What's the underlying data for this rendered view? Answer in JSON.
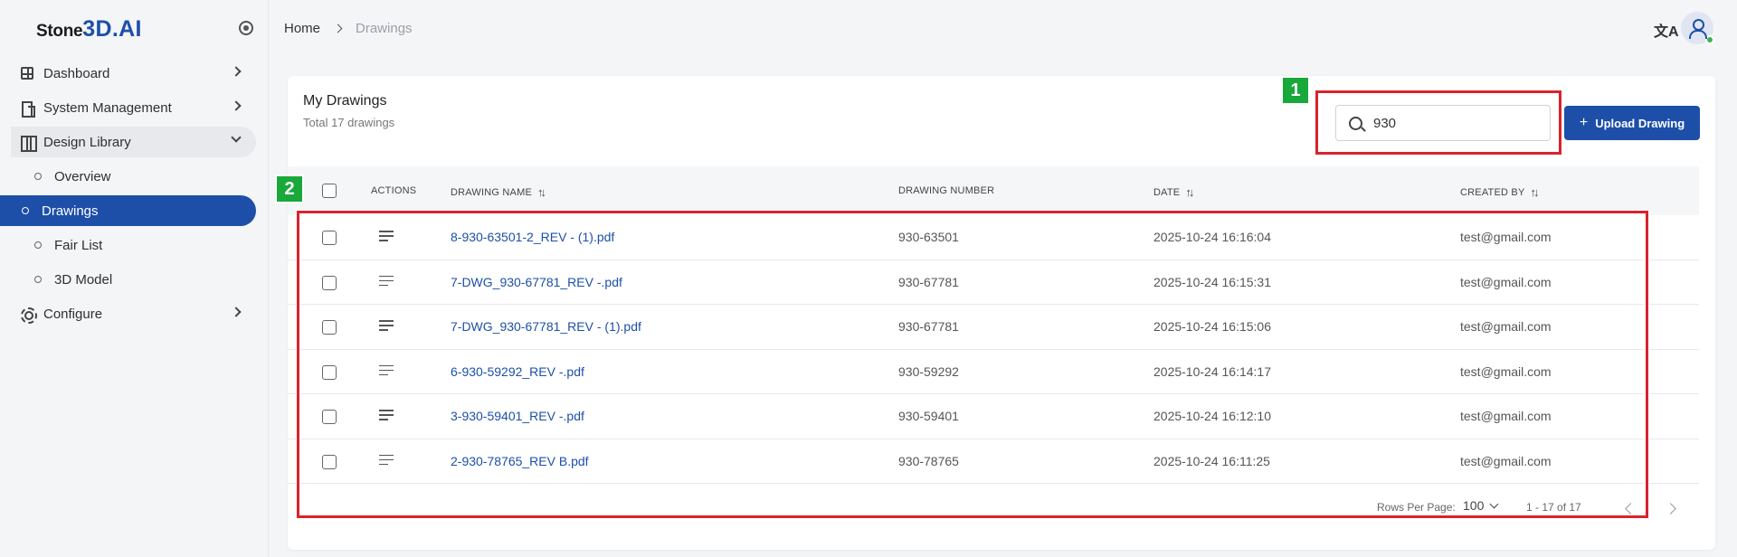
{
  "brand": {
    "part1": "Stone",
    "part2": "3D.AI"
  },
  "sidebar": {
    "items": [
      {
        "label": "Dashboard"
      },
      {
        "label": "System Management"
      },
      {
        "label": "Design Library"
      },
      {
        "label": "Overview"
      },
      {
        "label": "Drawings"
      },
      {
        "label": "Fair List"
      },
      {
        "label": "3D Model"
      },
      {
        "label": "Configure"
      }
    ]
  },
  "breadcrumb": {
    "home": "Home",
    "current": "Drawings"
  },
  "header": {
    "translate_glyph": "文A"
  },
  "card": {
    "title": "My Drawings",
    "subtitle": "Total 17 drawings",
    "search_value": "930",
    "upload_label": "Upload Drawing",
    "upload_plus": "+"
  },
  "table": {
    "headers": {
      "actions": "Actions",
      "name": "Drawing Name",
      "number": "Drawing Number",
      "date": "Date",
      "created_by": "Created By"
    },
    "sort_glyph": "↑↓",
    "rows": [
      {
        "name": "8-930-63501-2_REV - (1).pdf",
        "number": "930-63501",
        "date": "2025-10-24 16:16:04",
        "created_by": "test@gmail.com"
      },
      {
        "name": "7-DWG_930-67781_REV -.pdf",
        "number": "930-67781",
        "date": "2025-10-24 16:15:31",
        "created_by": "test@gmail.com"
      },
      {
        "name": "7-DWG_930-67781_REV - (1).pdf",
        "number": "930-67781",
        "date": "2025-10-24 16:15:06",
        "created_by": "test@gmail.com"
      },
      {
        "name": "6-930-59292_REV -.pdf",
        "number": "930-59292",
        "date": "2025-10-24 16:14:17",
        "created_by": "test@gmail.com"
      },
      {
        "name": "3-930-59401_REV -.pdf",
        "number": "930-59401",
        "date": "2025-10-24 16:12:10",
        "created_by": "test@gmail.com"
      },
      {
        "name": "2-930-78765_REV B.pdf",
        "number": "930-78765",
        "date": "2025-10-24 16:11:25",
        "created_by": "test@gmail.com"
      }
    ]
  },
  "pagination": {
    "rows_per_page_label": "Rows Per Page:",
    "rows_per_page": "100",
    "range": "1 - 17 of 17"
  },
  "annotations": {
    "badge1": "1",
    "badge2": "2"
  },
  "colors": {
    "primary": "#1d4fa8",
    "highlight": "#d9232d",
    "badge": "#19a83a",
    "online": "#3bb44a"
  }
}
